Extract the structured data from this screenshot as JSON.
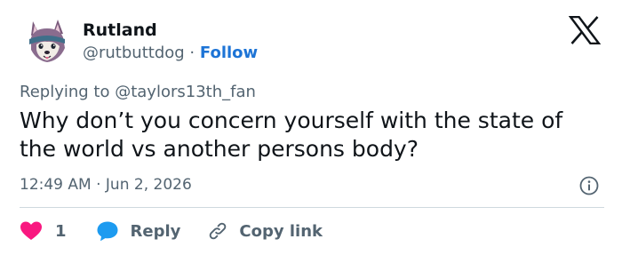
{
  "author": {
    "display_name": "Rutland",
    "handle": "@rutbuttdog",
    "separator": "·",
    "follow_label": "Follow"
  },
  "reply_context": {
    "prefix": "Replying to ",
    "target_handle": "@taylors13th_fan"
  },
  "tweet": {
    "text": "Why don’t you concern yourself with the state of the world vs another persons body?"
  },
  "meta": {
    "time": "12:49 AM",
    "separator": "·",
    "date": "Jun 2, 2026"
  },
  "actions": {
    "like_count": "1",
    "reply_label": "Reply",
    "copy_label": "Copy link"
  },
  "colors": {
    "text_primary": "#0f1419",
    "text_secondary": "#536471",
    "link_blue": "#1d74d6",
    "like_pink": "#f91880",
    "reply_blue": "#1d9bf0",
    "divider": "#cfd9de"
  },
  "icons": {
    "brand": "x-logo-icon",
    "like": "heart-icon",
    "reply": "speech-bubble-icon",
    "copy": "link-icon",
    "info": "info-icon"
  }
}
